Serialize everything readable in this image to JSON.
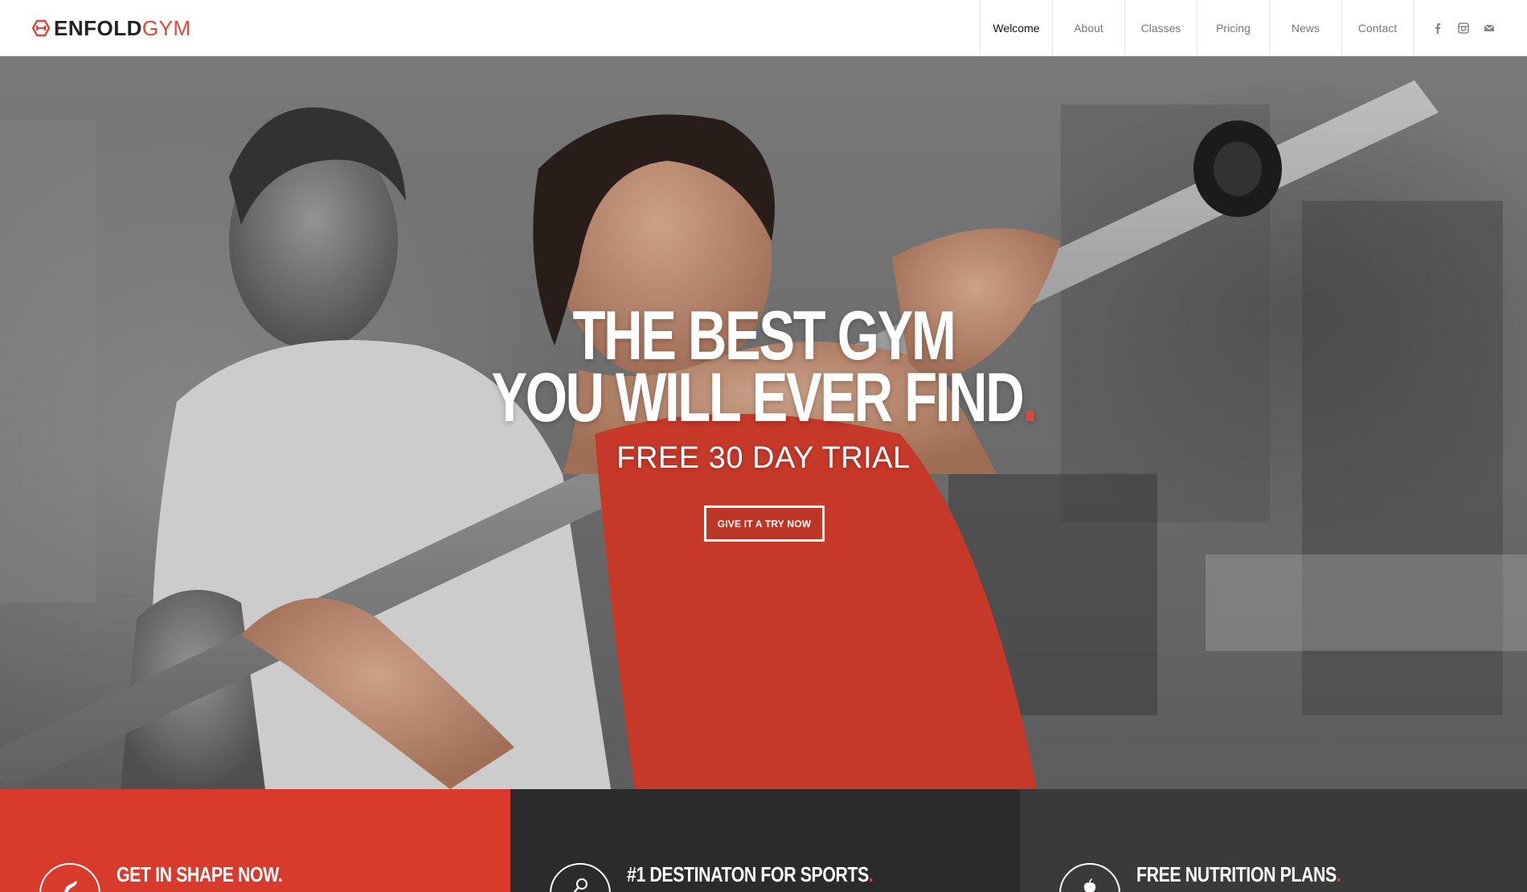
{
  "brand": {
    "name_primary": "ENFOLD",
    "name_secondary": "GYM",
    "accent_color": "#e0463a",
    "logo_icon": "dumbbell-hexagon-icon"
  },
  "nav": {
    "items": [
      {
        "label": "Welcome",
        "active": true
      },
      {
        "label": "About",
        "active": false
      },
      {
        "label": "Classes",
        "active": false
      },
      {
        "label": "Pricing",
        "active": false
      },
      {
        "label": "News",
        "active": false
      },
      {
        "label": "Contact",
        "active": false
      }
    ],
    "social": [
      {
        "icon": "facebook-icon"
      },
      {
        "icon": "instagram-icon"
      },
      {
        "icon": "mail-icon"
      }
    ]
  },
  "hero": {
    "title_line1": "THE BEST GYM",
    "title_line2": "YOU WILL EVER FIND",
    "title_dot": ".",
    "subtitle": "FREE 30 DAY TRIAL",
    "cta_label": "GIVE IT A TRY NOW"
  },
  "features": [
    {
      "title": "GET IN SHAPE NOW",
      "dot": ".",
      "icon": "arm-icon",
      "color": "#d83b2c"
    },
    {
      "title": "#1 DESTINATON FOR SPORTS",
      "dot": ".",
      "icon": "tennis-racket-icon",
      "color": "#2b2b2b"
    },
    {
      "title": "FREE NUTRITION PLANS",
      "dot": ".",
      "icon": "apple-icon",
      "color": "#3a3a3a"
    }
  ]
}
